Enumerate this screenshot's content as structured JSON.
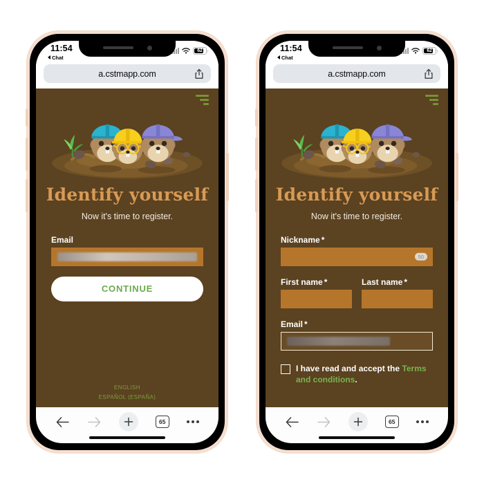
{
  "status_bar": {
    "time": "11:54",
    "back_app": "Chat",
    "battery": "62",
    "wifi_icon": "wifi-icon",
    "signal_icon": "cellular-signal-icon"
  },
  "browser": {
    "url": "a.cstmapp.com",
    "share_icon": "share-icon",
    "toolbar": {
      "back_icon": "arrow-left-icon",
      "forward_icon": "arrow-right-icon",
      "new_tab_icon": "plus-icon",
      "tab_count": "65",
      "more_icon": "more-dots-icon"
    }
  },
  "page": {
    "menu_icon": "hamburger-filter-icon",
    "illustration": "three-gophers-in-dirt-mound",
    "title": "Identify yourself",
    "subtitle": "Now it's time to register."
  },
  "screen_one": {
    "email_label": "Email",
    "email_value": "",
    "continue_label": "CONTINUE",
    "languages": [
      "ENGLISH",
      "ESPAÑOL (ESPAÑA)"
    ]
  },
  "screen_two": {
    "nickname_label": "Nickname",
    "nickname_required": "*",
    "nickname_counter": "50",
    "nickname_value": "",
    "first_name_label": "First name",
    "first_name_required": "*",
    "first_name_value": "",
    "last_name_label": "Last name",
    "last_name_required": "*",
    "last_name_value": "",
    "email_label": "Email",
    "email_required": "*",
    "email_value": "",
    "terms_text": "I have read and accept the",
    "terms_link": "Terms and conditions",
    "terms_period": ".",
    "terms_checked": false
  },
  "colors": {
    "page_bg": "#5b4220",
    "input_bg": "#b5762b",
    "title": "#d79a56",
    "accent_green": "#7ab34f",
    "menu_green": "#79913a",
    "continue_text": "#6cab4e"
  }
}
